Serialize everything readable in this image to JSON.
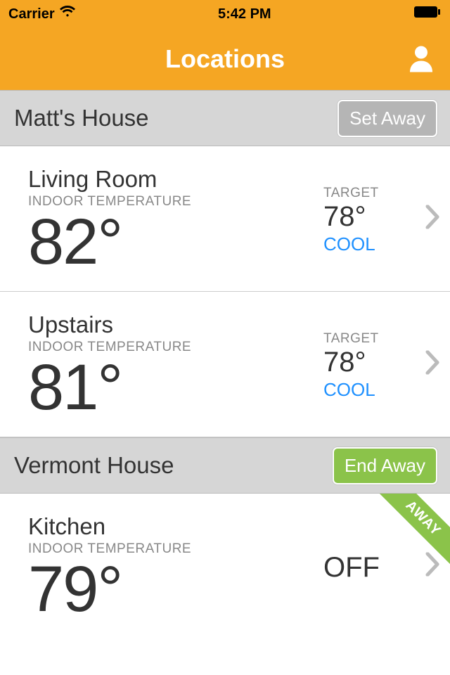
{
  "status": {
    "carrier": "Carrier",
    "time": "5:42 PM"
  },
  "nav": {
    "title": "Locations"
  },
  "labels": {
    "indoor": "INDOOR TEMPERATURE",
    "target": "TARGET"
  },
  "sections": [
    {
      "title": "Matt's House",
      "button_label": "Set Away",
      "button_style": "gray",
      "rooms": [
        {
          "name": "Living Room",
          "indoor": "82°",
          "target": "78°",
          "mode": "COOL",
          "mode_class": "cool",
          "has_target": true,
          "away": false
        },
        {
          "name": "Upstairs",
          "indoor": "81°",
          "target": "78°",
          "mode": "COOL",
          "mode_class": "cool",
          "has_target": true,
          "away": false
        }
      ]
    },
    {
      "title": "Vermont House",
      "button_label": "End Away",
      "button_style": "green",
      "rooms": [
        {
          "name": "Kitchen",
          "indoor": "79°",
          "off_label": "OFF",
          "has_target": false,
          "away": true,
          "away_label": "AWAY"
        }
      ]
    }
  ]
}
